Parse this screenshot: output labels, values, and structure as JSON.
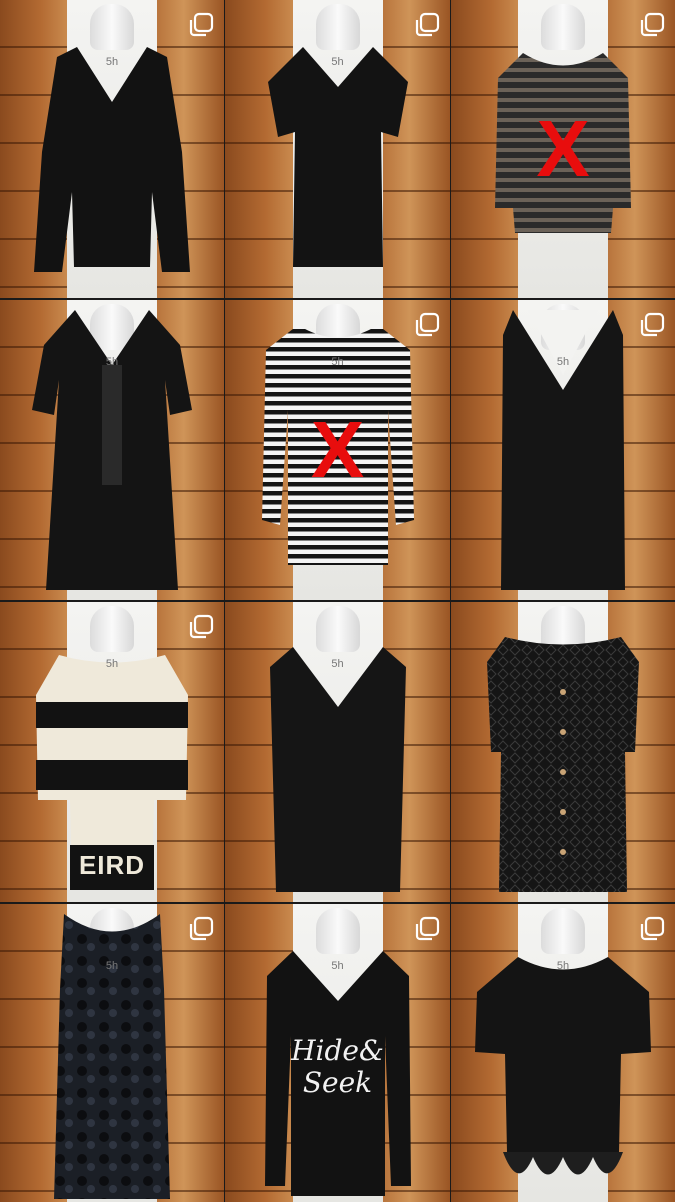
{
  "grid": {
    "items": [
      {
        "garment": "black-vneck-bell-sleeve-top",
        "marked_unavailable": false,
        "size_label": "5h"
      },
      {
        "garment": "black-tshirt-vneck",
        "marked_unavailable": false,
        "size_label": "5h"
      },
      {
        "garment": "grey-black-striped-cowl-neck-top",
        "marked_unavailable": true,
        "size_label": ""
      },
      {
        "garment": "black-embroidered-dress",
        "marked_unavailable": false,
        "size_label": "5h"
      },
      {
        "garment": "black-white-striped-longsleeve",
        "marked_unavailable": true,
        "size_label": "5h"
      },
      {
        "garment": "black-pinafore-dress",
        "marked_unavailable": false,
        "size_label": "5h"
      },
      {
        "garment": "black-cream-knit-sweater",
        "marked_unavailable": false,
        "size_label": "5h",
        "print_text": "EIRD"
      },
      {
        "garment": "black-vneck-long-vest",
        "marked_unavailable": false,
        "size_label": "5h"
      },
      {
        "garment": "black-lace-knit-cardigan-vest",
        "marked_unavailable": false,
        "size_label": ""
      },
      {
        "garment": "black-velvet-floral-slip-dress",
        "marked_unavailable": false,
        "size_label": "5h"
      },
      {
        "garment": "black-longsleeve-graphic-tee",
        "marked_unavailable": false,
        "size_label": "5h",
        "print_text_line1": "Hide&",
        "print_text_line2": "Seek"
      },
      {
        "garment": "black-ruffle-hem-knit-top",
        "marked_unavailable": false,
        "size_label": "5h"
      }
    ],
    "x_mark": "X"
  },
  "icons": {
    "select": "instagram-multi-select-icon"
  },
  "colors": {
    "x_mark": "#e80d0d",
    "garment_black": "#111111",
    "cream": "#efe9da"
  }
}
